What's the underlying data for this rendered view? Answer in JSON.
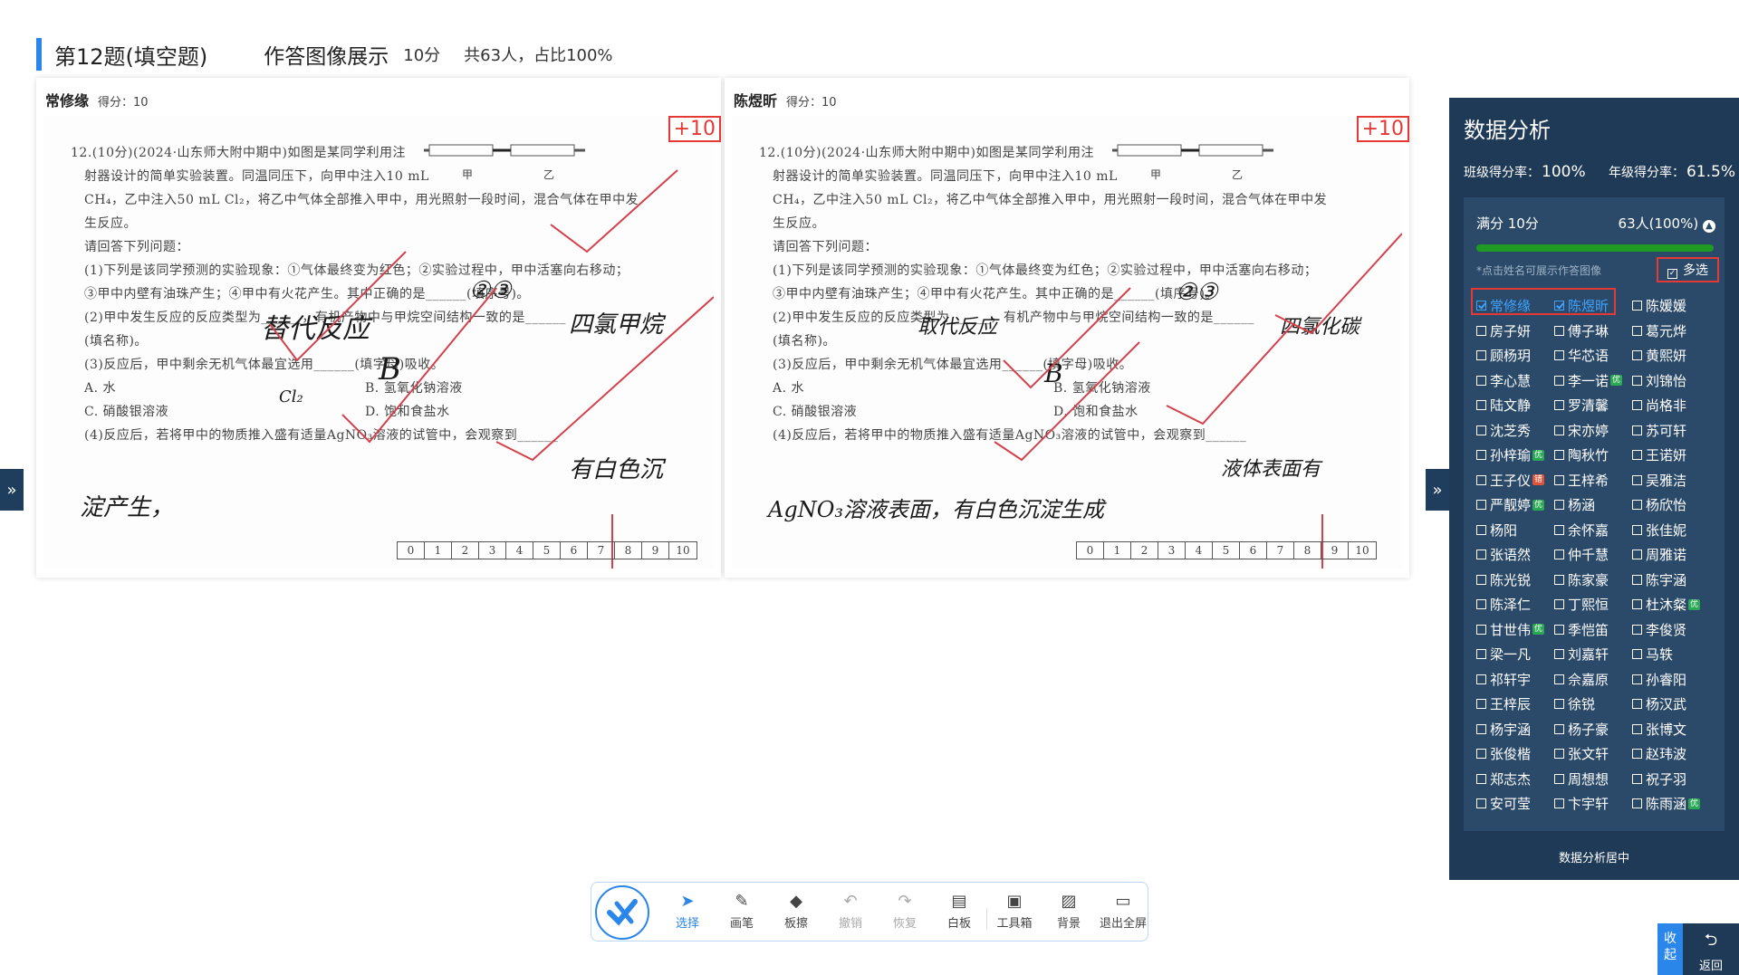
{
  "header": {
    "question_title": "第12题(填空题)",
    "subtitle": "作答图像展示",
    "score": "10分",
    "count": "共63人，占比100%"
  },
  "paper": {
    "lines": [
      "12.(10分)(2024·山东师大附中期中)如图是某同学利用注",
      "射器设计的简单实验装置。同温同压下，向甲中注入10 mL",
      "CH₄，乙中注入50 mL Cl₂，将乙中气体全部推入甲中，用光照射一段时间，混合气体在甲中发",
      "生反应。",
      "请回答下列问题：",
      "(1)下列是该同学预测的实验现象：①气体最终变为红色；②实验过程中，甲中活塞向右移动；",
      "③甲中内壁有油珠产生；④甲中有火花产生。其中正确的是______(填序号)。",
      "(2)甲中发生反应的反应类型为______，有机产物中与甲烷空间结构一致的是______",
      "(填名称)。",
      "(3)反应后，甲中剩余无机气体最宜选用______(填字母)吸收。",
      "A. 水",
      "B. 氢氧化钠溶液",
      "C. 硝酸银溶液",
      "D. 饱和食盐水",
      "(4)反应后，若将甲中的物质推入盛有适量AgNO₃溶液的试管中，会观察到______"
    ],
    "apparatus_a": "甲",
    "apparatus_b": "乙",
    "score_scale": [
      "0",
      "1",
      "2",
      "3",
      "4",
      "5",
      "6",
      "7",
      "8",
      "9",
      "10"
    ]
  },
  "cards": [
    {
      "name": "常修缘",
      "score_label": "得分：10",
      "mark": "+10",
      "answers": [
        "②③",
        "替代反应",
        "四氯甲烷",
        "B",
        "Cl₂",
        "有白色沉",
        "淀产生，"
      ]
    },
    {
      "name": "陈煜昕",
      "score_label": "得分：10",
      "mark": "+10",
      "answers": [
        "②③",
        "取代反应",
        "四氯化碳",
        "B",
        "液体表面有",
        "AgNO₃溶液表面，有白色沉淀生成"
      ]
    }
  ],
  "panel": {
    "title": "数据分析",
    "class_rate_label": "班级得分率：",
    "class_rate": "100%",
    "grade_rate_label": "年级得分率：",
    "grade_rate": "61.5%",
    "full_score": "满分 10分",
    "full_count": "63人(100%)",
    "progress_percent": 100,
    "hint": "*点击姓名可展示作答图像",
    "multi_label": "多选",
    "footer": "数据分析居中",
    "students": [
      {
        "name": "常修缘",
        "selected": true,
        "badge": ""
      },
      {
        "name": "陈煜昕",
        "selected": true,
        "badge": ""
      },
      {
        "name": "陈媛媛",
        "selected": false,
        "badge": ""
      },
      {
        "name": "房子妍",
        "selected": false,
        "badge": ""
      },
      {
        "name": "傅子琳",
        "selected": false,
        "badge": ""
      },
      {
        "name": "葛元烨",
        "selected": false,
        "badge": ""
      },
      {
        "name": "顾杨玥",
        "selected": false,
        "badge": ""
      },
      {
        "name": "华芯语",
        "selected": false,
        "badge": ""
      },
      {
        "name": "黄熙妍",
        "selected": false,
        "badge": ""
      },
      {
        "name": "李心慧",
        "selected": false,
        "badge": ""
      },
      {
        "name": "李一诺",
        "selected": false,
        "badge": "优"
      },
      {
        "name": "刘锦怡",
        "selected": false,
        "badge": ""
      },
      {
        "name": "陆文静",
        "selected": false,
        "badge": ""
      },
      {
        "name": "罗清馨",
        "selected": false,
        "badge": ""
      },
      {
        "name": "尚格非",
        "selected": false,
        "badge": ""
      },
      {
        "name": "沈芝秀",
        "selected": false,
        "badge": ""
      },
      {
        "name": "宋亦婷",
        "selected": false,
        "badge": ""
      },
      {
        "name": "苏可轩",
        "selected": false,
        "badge": ""
      },
      {
        "name": "孙梓瑜",
        "selected": false,
        "badge": "优"
      },
      {
        "name": "陶秋竹",
        "selected": false,
        "badge": ""
      },
      {
        "name": "王诺妍",
        "selected": false,
        "badge": ""
      },
      {
        "name": "王子仪",
        "selected": false,
        "badge": "错"
      },
      {
        "name": "王梓希",
        "selected": false,
        "badge": ""
      },
      {
        "name": "吴雅洁",
        "selected": false,
        "badge": ""
      },
      {
        "name": "严靓婷",
        "selected": false,
        "badge": "优"
      },
      {
        "name": "杨涵",
        "selected": false,
        "badge": ""
      },
      {
        "name": "杨欣怡",
        "selected": false,
        "badge": ""
      },
      {
        "name": "杨阳",
        "selected": false,
        "badge": ""
      },
      {
        "name": "余怀嘉",
        "selected": false,
        "badge": ""
      },
      {
        "name": "张佳妮",
        "selected": false,
        "badge": ""
      },
      {
        "name": "张语然",
        "selected": false,
        "badge": ""
      },
      {
        "name": "仲千慧",
        "selected": false,
        "badge": ""
      },
      {
        "name": "周雅诺",
        "selected": false,
        "badge": ""
      },
      {
        "name": "陈光锐",
        "selected": false,
        "badge": ""
      },
      {
        "name": "陈家豪",
        "selected": false,
        "badge": ""
      },
      {
        "name": "陈宇涵",
        "selected": false,
        "badge": ""
      },
      {
        "name": "陈泽仁",
        "selected": false,
        "badge": ""
      },
      {
        "name": "丁熙恒",
        "selected": false,
        "badge": ""
      },
      {
        "name": "杜沐粲",
        "selected": false,
        "badge": "优"
      },
      {
        "name": "甘世伟",
        "selected": false,
        "badge": "优"
      },
      {
        "name": "季恺笛",
        "selected": false,
        "badge": ""
      },
      {
        "name": "李俊贤",
        "selected": false,
        "badge": ""
      },
      {
        "name": "梁一凡",
        "selected": false,
        "badge": ""
      },
      {
        "name": "刘嘉轩",
        "selected": false,
        "badge": ""
      },
      {
        "name": "马轶",
        "selected": false,
        "badge": ""
      },
      {
        "name": "祁轩宇",
        "selected": false,
        "badge": ""
      },
      {
        "name": "佘嘉原",
        "selected": false,
        "badge": ""
      },
      {
        "name": "孙睿阳",
        "selected": false,
        "badge": ""
      },
      {
        "name": "王梓辰",
        "selected": false,
        "badge": ""
      },
      {
        "name": "徐锐",
        "selected": false,
        "badge": ""
      },
      {
        "name": "杨汉武",
        "selected": false,
        "badge": ""
      },
      {
        "name": "杨宇涵",
        "selected": false,
        "badge": ""
      },
      {
        "name": "杨子豪",
        "selected": false,
        "badge": ""
      },
      {
        "name": "张博文",
        "selected": false,
        "badge": ""
      },
      {
        "name": "张俊楷",
        "selected": false,
        "badge": ""
      },
      {
        "name": "张文轩",
        "selected": false,
        "badge": ""
      },
      {
        "name": "赵玮波",
        "selected": false,
        "badge": ""
      },
      {
        "name": "郑志杰",
        "selected": false,
        "badge": ""
      },
      {
        "name": "周想想",
        "selected": false,
        "badge": ""
      },
      {
        "name": "祝子羽",
        "selected": false,
        "badge": ""
      },
      {
        "name": "安可莹",
        "selected": false,
        "badge": ""
      },
      {
        "name": "卞宇轩",
        "selected": false,
        "badge": ""
      },
      {
        "name": "陈雨涵",
        "selected": false,
        "badge": "优"
      }
    ]
  },
  "toolbar": {
    "tools": [
      {
        "label": "选择",
        "icon": "cursor-icon",
        "glyph": "➤",
        "state": "active"
      },
      {
        "label": "画笔",
        "icon": "pen-icon",
        "glyph": "✎",
        "state": ""
      },
      {
        "label": "板擦",
        "icon": "eraser-icon",
        "glyph": "◆",
        "state": ""
      },
      {
        "label": "撤销",
        "icon": "undo-icon",
        "glyph": "↶",
        "state": "dim"
      },
      {
        "label": "恢复",
        "icon": "redo-icon",
        "glyph": "↷",
        "state": "dim"
      },
      {
        "label": "白板",
        "icon": "whiteboard-icon",
        "glyph": "▤",
        "state": ""
      },
      {
        "label": "工具箱",
        "icon": "toolbox-icon",
        "glyph": "▣",
        "state": ""
      },
      {
        "label": "背景",
        "icon": "background-icon",
        "glyph": "▨",
        "state": ""
      },
      {
        "label": "退出全屏",
        "icon": "exit-fullscreen-icon",
        "glyph": "▭",
        "state": ""
      }
    ]
  },
  "corner": {
    "collapse_label": "收起",
    "back_label": "返回"
  },
  "colors": {
    "accent": "#2a86e8",
    "panel_bg": "#1e3a56",
    "panel_inner": "#2b4a69",
    "progress": "#1f9b24",
    "mark_red": "#e53935"
  }
}
